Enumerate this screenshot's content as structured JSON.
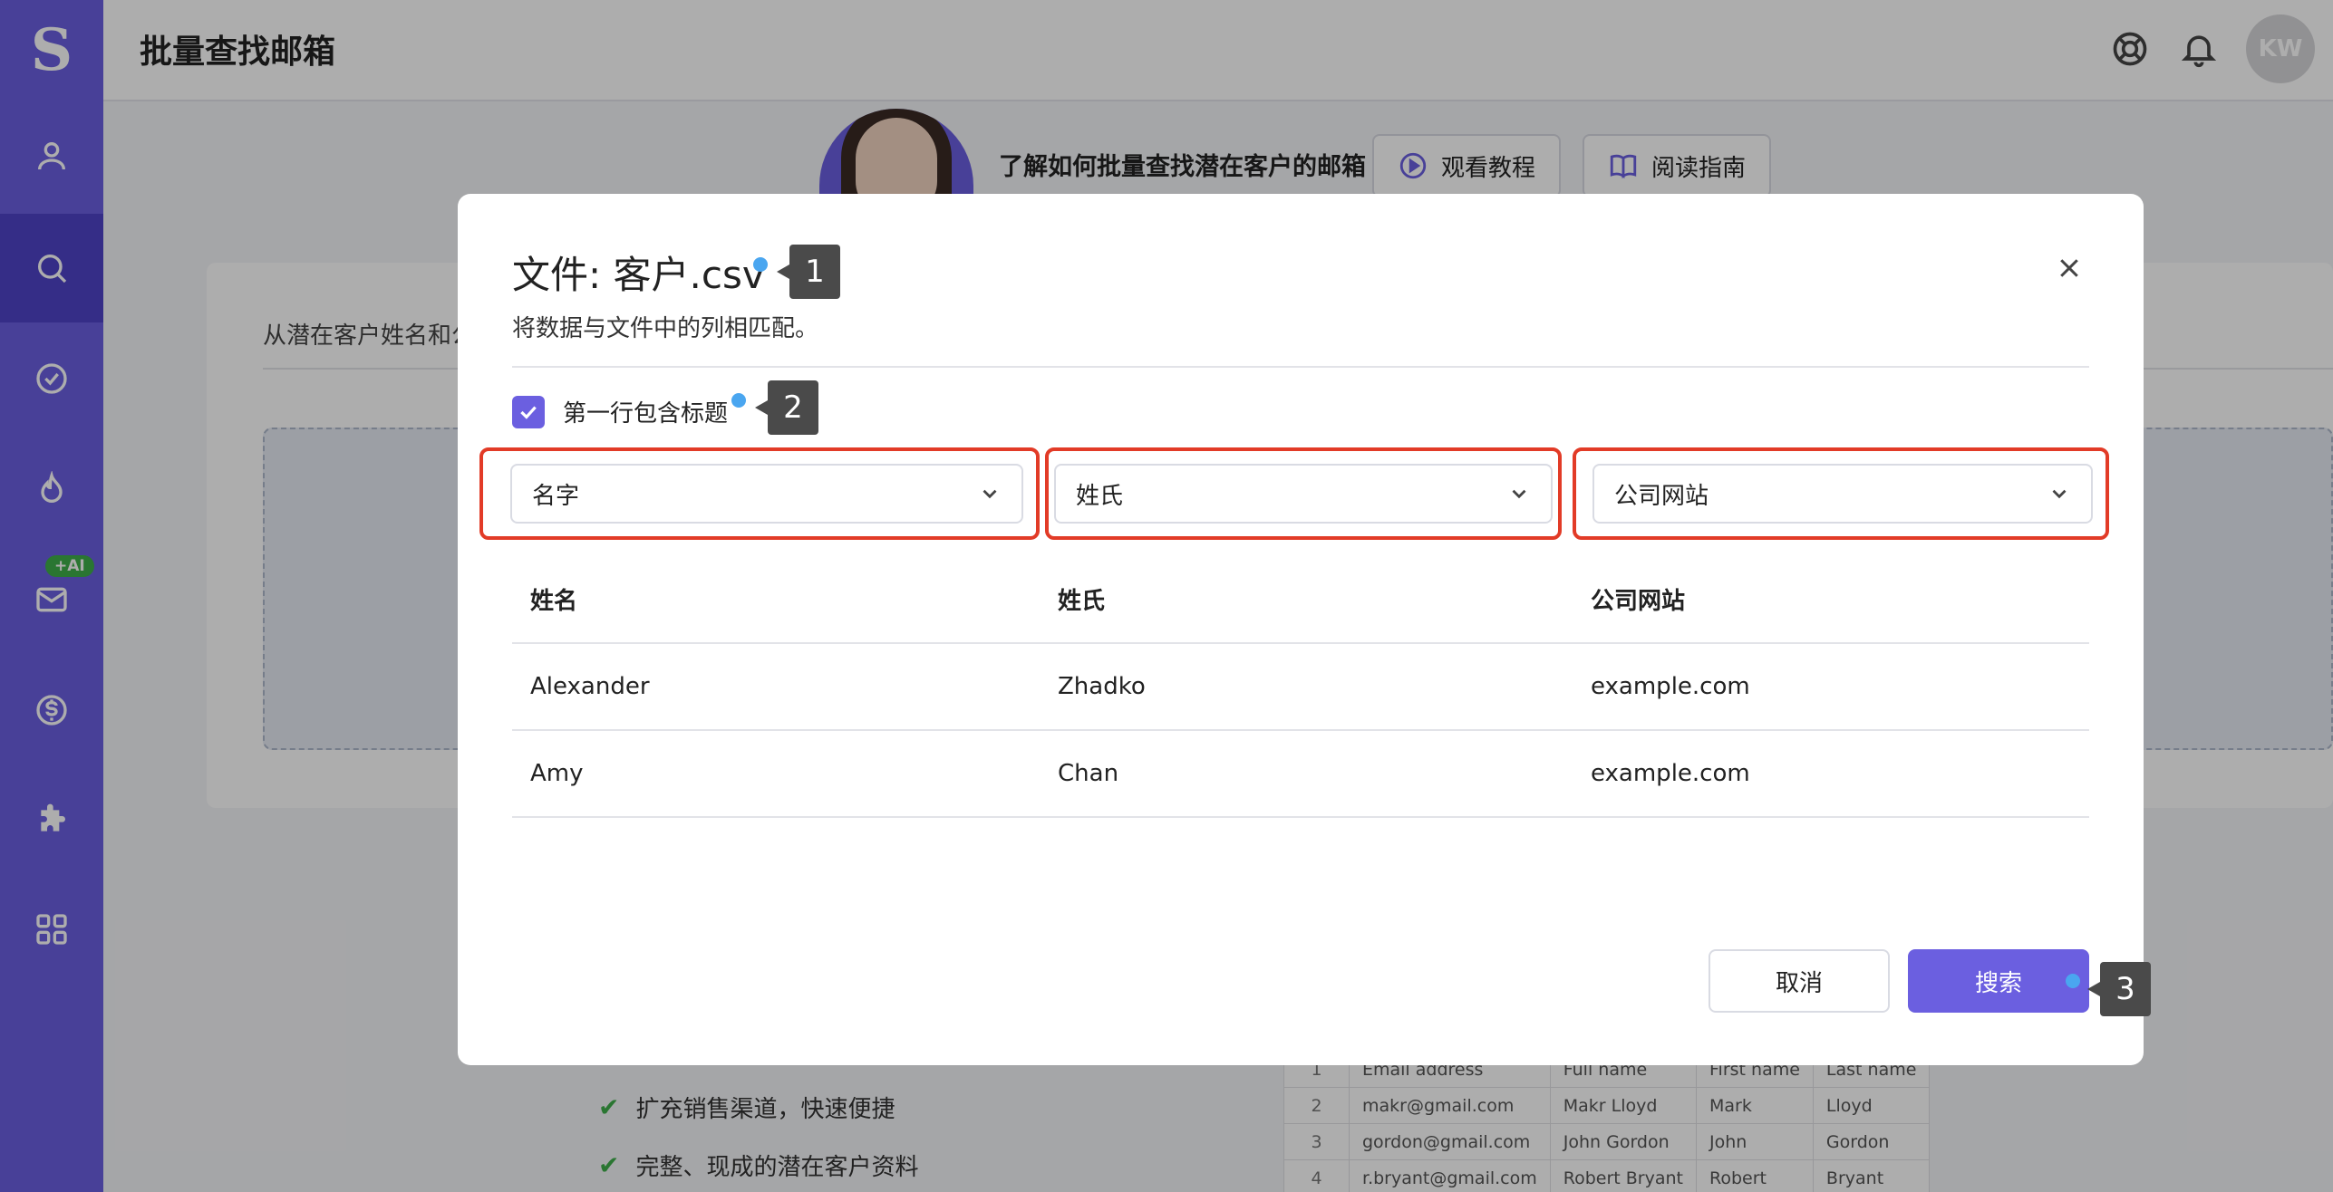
{
  "app": {
    "logo": "S",
    "page_title": "批量查找邮箱",
    "ai_badge": "+AI"
  },
  "sidebar": {
    "items": [
      {
        "name": "person-icon"
      },
      {
        "name": "search-icon",
        "active": true
      },
      {
        "name": "check-circle-icon"
      },
      {
        "name": "flame-icon"
      },
      {
        "name": "mail-icon"
      },
      {
        "name": "dollar-icon"
      },
      {
        "name": "puzzle-icon"
      },
      {
        "name": "grid-icon"
      }
    ]
  },
  "topbar": {
    "help_icon": "lifebuoy-icon",
    "bell_icon": "bell-icon",
    "avatar_initials": "KW"
  },
  "promo": {
    "text": "了解如何批量查找潜在客户的邮箱",
    "watch_label": "观看教程",
    "read_label": "阅读指南"
  },
  "background": {
    "hint": "从潜在客户姓名和公",
    "features": [
      "扩充销售渠道，快速便捷",
      "完整、现成的潜在客户资料"
    ],
    "sample_table": {
      "header": [
        "1",
        "Email address",
        "Full name",
        "First name",
        "Last name"
      ],
      "rows": [
        [
          "2",
          "makr@gmail.com",
          "Makr Lloyd",
          "Mark",
          "Lloyd"
        ],
        [
          "3",
          "gordon@gmail.com",
          "John Gordon",
          "John",
          "Gordon"
        ],
        [
          "4",
          "r.bryant@gmail.com",
          "Robert Bryant",
          "Robert",
          "Bryant"
        ]
      ]
    }
  },
  "modal": {
    "title": "文件: 客户.csv",
    "subtitle": "将数据与文件中的列相匹配。",
    "first_row_header_label": "第一行包含标题",
    "first_row_header_checked": true,
    "selects": [
      "名字",
      "姓氏",
      "公司网站"
    ],
    "table": {
      "headers": [
        "姓名",
        "姓氏",
        "公司网站"
      ],
      "rows": [
        [
          "Alexander",
          "Zhadko",
          "example.com"
        ],
        [
          "Amy",
          "Chan",
          "example.com"
        ]
      ]
    },
    "cancel_label": "取消",
    "search_label": "搜索",
    "markers": [
      "1",
      "2",
      "3"
    ]
  },
  "colors": {
    "brand": "#6b5fe0",
    "highlight": "#e23b27",
    "dot": "#4aa6f0",
    "overlay": "rgba(0,0,0,0.32)"
  }
}
